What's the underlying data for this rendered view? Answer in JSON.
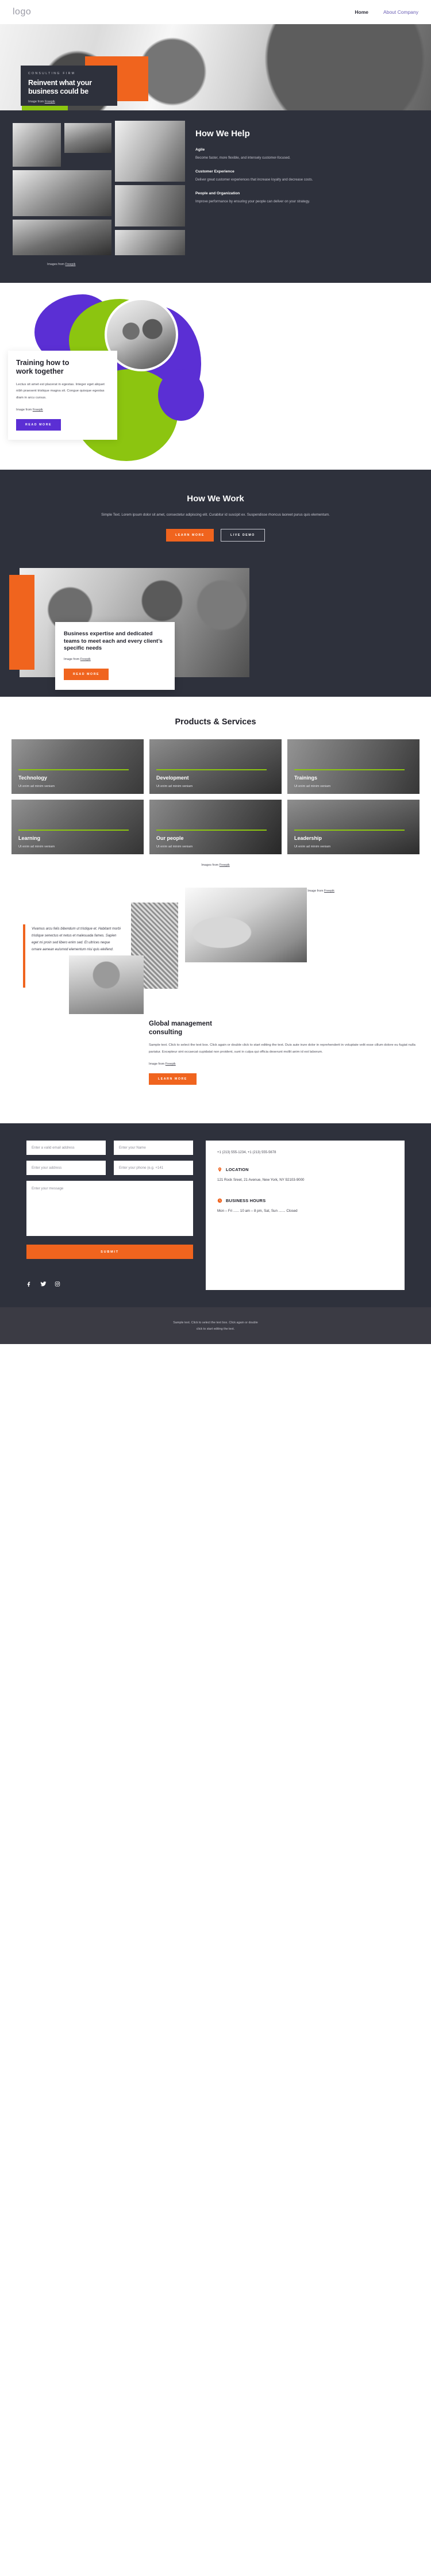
{
  "nav": {
    "logo": "logo",
    "links": [
      {
        "label": "Home"
      },
      {
        "label": "About Company"
      }
    ]
  },
  "hero": {
    "eyebrow": "CONSULTING FIRM",
    "title_line1": "Reinvent what your",
    "title_line2": "business could be",
    "credit_prefix": "Image from ",
    "credit_link": "Freepik"
  },
  "help": {
    "heading": "How We Help",
    "gallery_credit_prefix": "Images from ",
    "gallery_credit_link": "Freepik",
    "items": [
      {
        "title": "Agile",
        "text": "Become faster, more flexible, and intensely customer-focused."
      },
      {
        "title": "Customer Experience",
        "text": "Deliver great customer experiences that increase loyalty and decrease costs."
      },
      {
        "title": "People and Organization",
        "text": "Improve performance by ensuring your people can deliver on your strategy."
      }
    ]
  },
  "training": {
    "heading_line1": "Training how to",
    "heading_line2": "work together",
    "paragraph": "Lectus sit amet est placerat in egestas. Integer eget aliquet nibh praesent tristique magna sit. Congue quisque egestas diam in arcu cursus.",
    "credit_prefix": "Image from ",
    "credit_link": "Freepik",
    "button": "READ MORE"
  },
  "work": {
    "heading": "How We Work",
    "paragraph": "Simple Text. Lorem ipsum dolor sit amet, consectetur adipiscing elit. Curabitur id suscipit ex. Suspendisse rhoncus laoreet purus quis elementum.",
    "primary_button": "LEARN MORE",
    "secondary_button": "LIVE DEMO"
  },
  "expertise": {
    "heading": "Business expertise and dedicated teams to meet each and every client’s specific needs",
    "credit_prefix": "Image from ",
    "credit_link": "Freepik",
    "button": "READ MORE"
  },
  "products": {
    "heading": "Products & Services",
    "credit_prefix": "Images from ",
    "credit_link": "Freepik",
    "cards": [
      {
        "title": "Technology",
        "subtitle": "Ut enim ad minim veniam"
      },
      {
        "title": "Development",
        "subtitle": "Ut enim ad minim veniam"
      },
      {
        "title": "Trainings",
        "subtitle": "Ut enim ad minim veniam"
      },
      {
        "title": "Learning",
        "subtitle": "Ut enim ad minim veniam"
      },
      {
        "title": "Our people",
        "subtitle": "Ut enim ad minim veniam"
      },
      {
        "title": "Leadership",
        "subtitle": "Ut enim ad minim veniam"
      }
    ]
  },
  "quote": {
    "text": "Vivamus arcu felis bibendum ut tristique et. Habitant morbi tristique senectus et netus et malesuada fames. Sapien eget mi proin sed libero enim sed. Et ultrices neque ornare aenean euismod elementum nisi quis eleifend.",
    "credit_prefix": "Image from ",
    "credit_link": "Freepik"
  },
  "global": {
    "heading_line1": "Global management",
    "heading_line2": "consulting",
    "paragraph": "Sample text. Click to select the text box. Click again or double click to start editing the text. Duis aute irure dolor in reprehenderit in voluptate velit esse cillum dolore eu fugiat nulla pariatur. Excepteur sint occaecat cupidatat non proident, sunt in culpa qui officia deserunt mollit anim id est laborum.",
    "credit_prefix": "Image from ",
    "credit_link": "Freepik",
    "button": "LEARN MORE"
  },
  "contact": {
    "fields": {
      "email_placeholder": "Enter a valid email address",
      "name_placeholder": "Enter your Name",
      "address_placeholder": "Enter your address",
      "phone_placeholder": "Enter your phone (e.g. +141",
      "message_placeholder": "Enter your message"
    },
    "submit_label": "SUBMIT",
    "socials": [
      {
        "name": "facebook-icon"
      },
      {
        "name": "twitter-icon"
      },
      {
        "name": "instagram-icon"
      }
    ],
    "info": {
      "phones": "+1 (213) 555-1234, +1 (213) 555-5678",
      "location_title": "LOCATION",
      "location_text": "121 Rock Sreet, 21 Avenue, New York, NY 92103-9000",
      "hours_title": "BUSINESS HOURS",
      "hours_text": "Mon – Fri ...... 10 am – 8 pm, Sat, Sun ....... Closed"
    }
  },
  "footer": {
    "line1": "Sample text. Click to select the text box. Click again or double",
    "line2": "click to start editing the text."
  },
  "colors": {
    "dark": "#2e313c",
    "orange": "#f0641e",
    "green": "#8cc510",
    "purple": "#5b2fd4",
    "footer": "#3b3b44"
  }
}
